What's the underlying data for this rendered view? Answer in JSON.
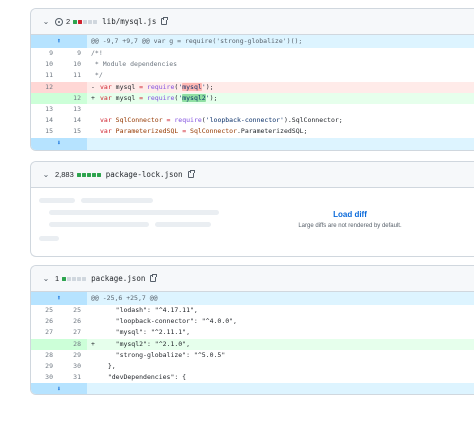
{
  "colors": {
    "added": "#2da44e",
    "removed": "#cf222e",
    "neutral": "#d0d7de",
    "link": "#0969da"
  },
  "icons": {
    "collapse": "chevron-down-icon",
    "copy": "copy-icon",
    "expand": "expand-icon",
    "modified": "dot-fill-icon"
  },
  "files": [
    {
      "name": "lib/mysql.js",
      "change_count": "2",
      "hunk": "@@ -9,7 +9,7 @@ var g = require('strong-globalize')();",
      "rows": [
        {
          "old": "9",
          "new": "9",
          "text": "/*!"
        },
        {
          "old": "10",
          "new": "10",
          "text": " * Module dependencies"
        },
        {
          "old": "11",
          "new": "11",
          "text": " */"
        },
        {
          "old": "12",
          "new": "",
          "marker": "-",
          "kw": "var",
          "var": " mysql",
          "eq": " = ",
          "fn": "require",
          "lp": "(",
          "str_open": "'",
          "hl": "mysql",
          "str_close": "'",
          "rp": ");"
        },
        {
          "old": "",
          "new": "12",
          "marker": "+",
          "kw": "var",
          "var": " mysql",
          "eq": " = ",
          "fn": "require",
          "lp": "(",
          "str_open": "'",
          "hl": "mysql2",
          "str_close": "'",
          "rp": ");"
        },
        {
          "old": "13",
          "new": "13",
          "text": ""
        },
        {
          "old": "14",
          "new": "14",
          "kw": "var",
          "var": " SqlConnector",
          "eq": " = ",
          "fn": "require",
          "lp": "(",
          "str": "'loopback-connector'",
          "rp": ").SqlConnector;"
        },
        {
          "old": "15",
          "new": "15",
          "kw": "var",
          "var": " ParameterizedSQL",
          "eq": " = ",
          "obj": "SqlConnector",
          "rp": ".ParameterizedSQL;"
        }
      ]
    },
    {
      "name": "package-lock.json",
      "change_count": "2,883",
      "load_diff": "Load diff",
      "load_note": "Large diffs are not rendered by default."
    },
    {
      "name": "package.json",
      "change_count": "1",
      "hunk": "@@ -25,6 +25,7 @@",
      "rows": [
        {
          "old": "25",
          "new": "25",
          "text": "    \"lodash\": \"^4.17.11\","
        },
        {
          "old": "26",
          "new": "26",
          "text": "    \"loopback-connector\": \"^4.0.0\","
        },
        {
          "old": "27",
          "new": "27",
          "text": "    \"mysql\": \"^2.11.1\","
        },
        {
          "old": "",
          "new": "28",
          "marker": "+",
          "text": "    \"mysql2\": \"^2.1.0\","
        },
        {
          "old": "28",
          "new": "29",
          "text": "    \"strong-globalize\": \"^5.0.5\""
        },
        {
          "old": "29",
          "new": "30",
          "text": "  },"
        },
        {
          "old": "30",
          "new": "31",
          "text": "  \"devDependencies\": {"
        }
      ]
    }
  ]
}
